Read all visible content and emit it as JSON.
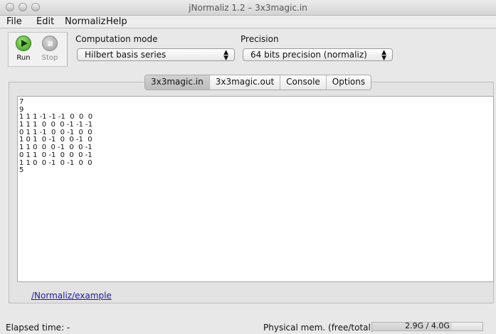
{
  "window": {
    "title": "jNormaliz 1.2 – 3x3magic.in"
  },
  "menu": [
    "File",
    "Edit",
    "Normaliz",
    "Help"
  ],
  "toolbar": {
    "run_label": "Run",
    "stop_label": "Stop"
  },
  "settings": {
    "computation_mode_label": "Computation mode",
    "computation_mode_value": "Hilbert basis series",
    "precision_label": "Precision",
    "precision_value": "64 bits precision (normaliz)"
  },
  "tabs": [
    {
      "label": "3x3magic.in",
      "active": true
    },
    {
      "label": "3x3magic.out",
      "active": false
    },
    {
      "label": "Console",
      "active": false
    },
    {
      "label": "Options",
      "active": false
    }
  ],
  "editor": {
    "lines": [
      "7",
      "9",
      "1 1 1 -1 -1 -1  0  0  0",
      "1 1 1  0  0  0 -1 -1 -1",
      "0 1 1 -1  0  0 -1  0  0",
      "1 0 1  0 -1  0  0 -1  0",
      "1 1 0  0  0 -1  0  0 -1",
      "0 1 1  0 -1  0  0  0 -1",
      "1 1 0  0 -1  0 -1  0  0",
      "5"
    ]
  },
  "path_link": "/Normaliz/example",
  "status": {
    "elapsed": "Elapsed time: -",
    "mem_label": "Physical mem. (free/total):",
    "mem_value": "2.9G / 4.0G",
    "mem_fraction": 0.725
  }
}
